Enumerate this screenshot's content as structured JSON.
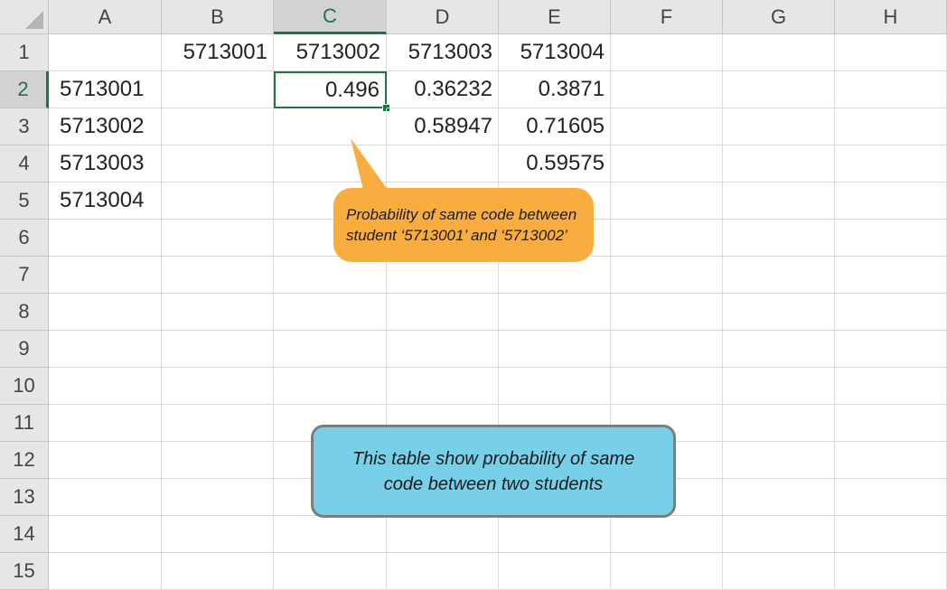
{
  "columns": [
    "A",
    "B",
    "C",
    "D",
    "E",
    "F",
    "G",
    "H"
  ],
  "rows": [
    "1",
    "2",
    "3",
    "4",
    "5",
    "6",
    "7",
    "8",
    "9",
    "10",
    "11",
    "12",
    "13",
    "14",
    "15"
  ],
  "selection": {
    "column": "C",
    "row": "2"
  },
  "cells": {
    "B1": "5713001",
    "C1": "5713002",
    "D1": "5713003",
    "E1": "5713004",
    "A2": "5713001",
    "C2": "0.496",
    "D2": "0.36232",
    "E2": "0.3871",
    "A3": "5713002",
    "D3": "0.58947",
    "E3": "0.71605",
    "A4": "5713003",
    "E4": "0.59575",
    "A5": "5713004"
  },
  "callouts": {
    "orange": "Probability of same code between student ‘5713001’ and ‘5713002’",
    "blue": "This table show probability of same code between two students"
  },
  "colors": {
    "accent": "#217346",
    "orange_callout": "#f9ad3f",
    "blue_callout": "#77cfe8"
  }
}
